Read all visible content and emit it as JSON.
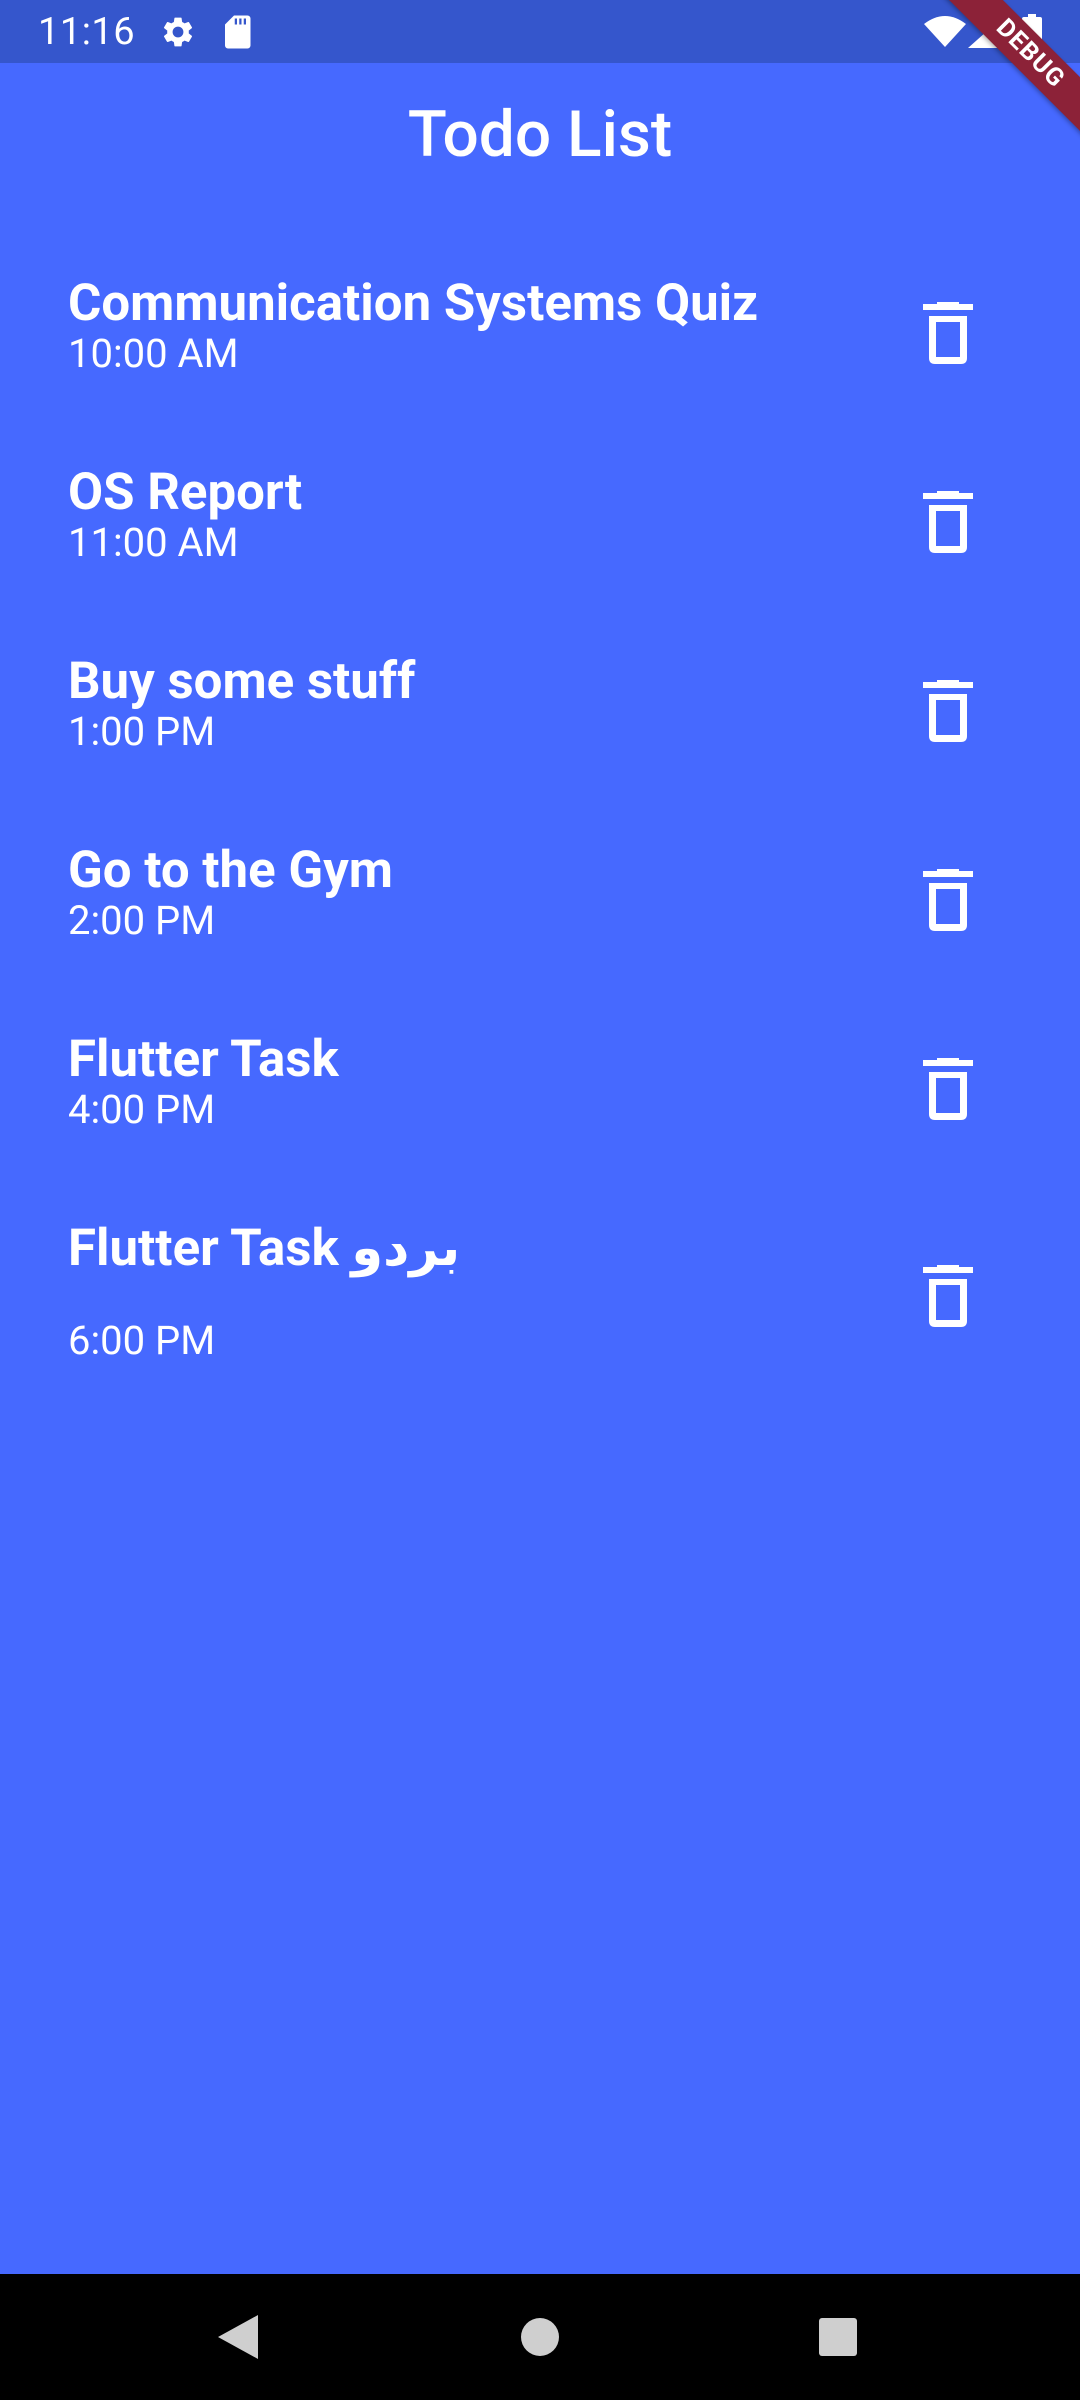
{
  "status_bar": {
    "time": "11:16",
    "icons": [
      "gear-icon",
      "sd-card-icon",
      "wifi-icon",
      "signal-icon",
      "battery-icon"
    ]
  },
  "debug_banner": "DEBUG",
  "app": {
    "title": "Todo List",
    "background_color": "#4669FF"
  },
  "todos": [
    {
      "title": "Communication Systems Quiz",
      "time": "10:00 AM"
    },
    {
      "title": "OS Report",
      "time": "11:00 AM"
    },
    {
      "title": "Buy some stuff",
      "time": "1:00 PM"
    },
    {
      "title": "Go to the Gym",
      "time": "2:00 PM"
    },
    {
      "title": "Flutter Task",
      "time": "4:00 PM"
    },
    {
      "title": "Flutter Task بردو",
      "time": "6:00 PM"
    }
  ],
  "nav_bar": {
    "icons": [
      "back-icon",
      "home-icon",
      "recents-icon"
    ]
  }
}
